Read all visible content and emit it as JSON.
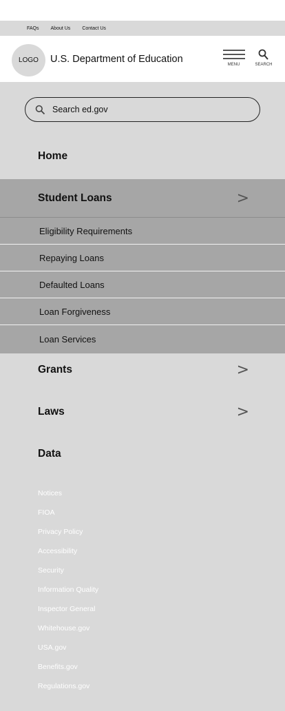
{
  "utility_links": [
    "FAQs",
    "About Us",
    "Contact Us"
  ],
  "header": {
    "logo_text": "LOGO",
    "title": "U.S. Department of Education",
    "menu_label": "MENU",
    "search_label": "SEARCH"
  },
  "search": {
    "placeholder": "Search ed.gov"
  },
  "nav": {
    "home": "Home",
    "student_loans": "Student Loans",
    "student_loans_sub": [
      "Eligibility Requirements",
      "Repaying Loans",
      "Defaulted Loans",
      "Loan Forgiveness",
      "Loan Services"
    ],
    "grants": "Grants",
    "laws": "Laws",
    "data": "Data",
    "chevron": ">"
  },
  "footer_links": [
    "Notices",
    "FIOA",
    "Privacy Policy",
    "Accessibility",
    "Security",
    "Information Quality",
    "Inspector General",
    "Whitehouse.gov",
    "USA.gov",
    "Benefits.gov",
    "Regulations.gov"
  ],
  "colors": {
    "panel_bg": "#d9d9d9",
    "expanded_bg": "#a6a6a6",
    "footer_link": "#ffffff"
  }
}
